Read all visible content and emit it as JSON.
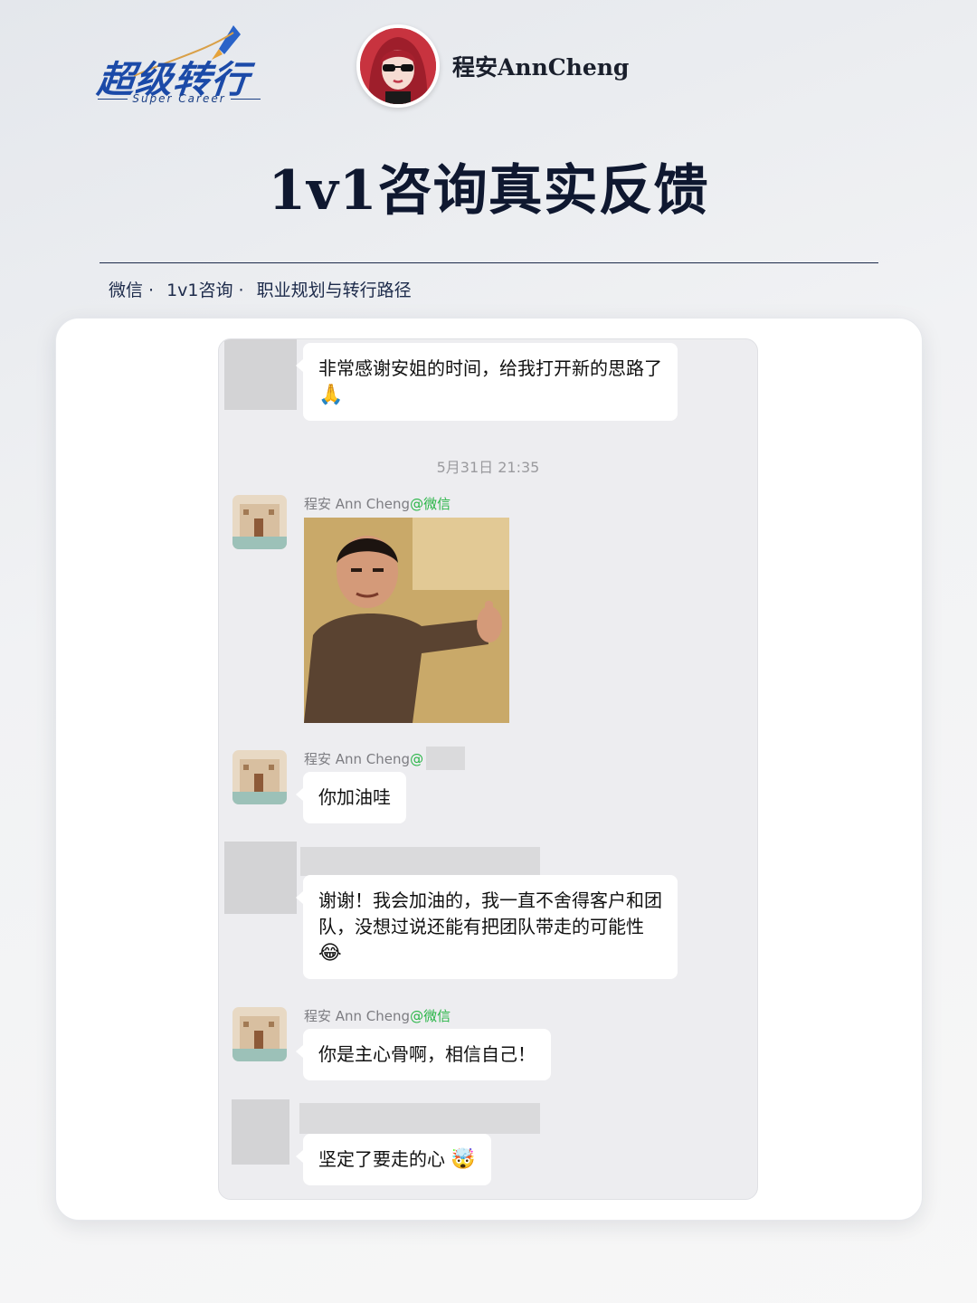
{
  "brand": {
    "name": "超级转行",
    "subtitle": "Super Career"
  },
  "author": {
    "name": "程安AnnCheng"
  },
  "page": {
    "title": "1v1咨询真实反馈"
  },
  "tags": [
    "微信 ·",
    "1v1咨询 ·",
    "职业规划与转行路径"
  ],
  "chat": {
    "messages": [
      {
        "from": "client",
        "text": "非常感谢安姐的时间，给我打开新的思路了",
        "emoji": "🙏"
      },
      {
        "type": "timestamp",
        "text": "5月31日 21:35"
      },
      {
        "from": "consultant",
        "sender_name": "程安 Ann Cheng",
        "sender_source": "@微信",
        "type": "image",
        "image_icon": "thumbs-up-meme-image"
      },
      {
        "from": "consultant",
        "sender_name": "程安 Ann Cheng",
        "sender_source": "@",
        "text": "你加油哇"
      },
      {
        "from": "client",
        "text": "谢谢！我会加油的，我一直不舍得客户和团队，没想过说还能有把团队带走的可能性",
        "emoji": "😂"
      },
      {
        "from": "consultant",
        "sender_name": "程安 Ann Cheng",
        "sender_source": "@微信",
        "text": "你是主心骨啊，相信自己！"
      },
      {
        "from": "client",
        "text": "坚定了要走的心",
        "emoji": "🤯"
      }
    ]
  },
  "colors": {
    "brand_blue": "#1b4aa8",
    "title_navy": "#0f1830",
    "wechat_green": "#28b546",
    "chat_bg": "#ededf0",
    "bubble_bg": "#ffffff"
  }
}
